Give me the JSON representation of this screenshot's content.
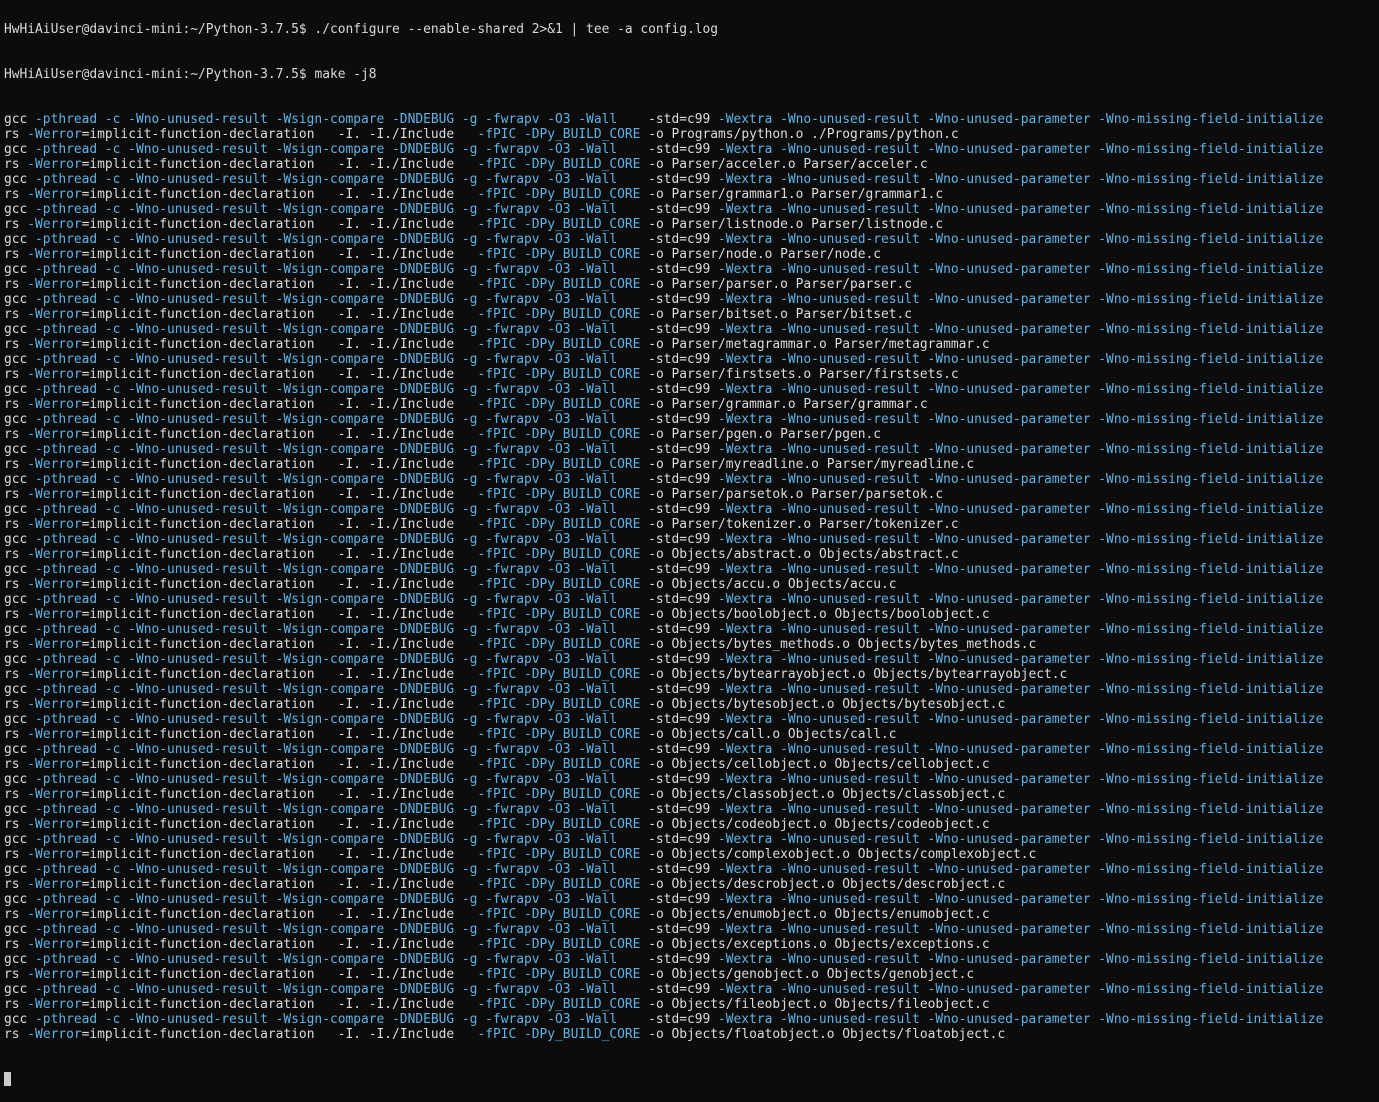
{
  "terminal": {
    "top_partial_line": "HwHiAiUser@davinci-mini:~/Python-3.7.5$ ./configure --enable-shared 2>&1 | tee -a config.log",
    "prompt": "HwHiAiUser@davinci-mini:~/Python-3.7.5$ ",
    "command": "make -j8",
    "line1_segments": [
      {
        "t": "gcc ",
        "c": "w"
      },
      {
        "t": "-pthread -c -Wno-unused-result -Wsign-compare -DNDEBUG -g -fwrapv -O3 -Wall    ",
        "c": "c"
      },
      {
        "t": "-std=c99 ",
        "c": "w"
      },
      {
        "t": "-Wextra -Wno-unused-result -Wno-unused-parameter -Wno-missing-field-initialize",
        "c": "c"
      }
    ],
    "line2_prefix": [
      {
        "t": "rs ",
        "c": "w"
      },
      {
        "t": "-Werror",
        "c": "c"
      },
      {
        "t": "=implicit-function-declaration   -I. -I./Include   ",
        "c": "w"
      },
      {
        "t": "-fPIC -DPy_BUILD_CORE ",
        "c": "c"
      },
      {
        "t": "-o ",
        "c": "w"
      }
    ],
    "compile_targets": [
      "Programs/python.o ./Programs/python.c",
      "Parser/acceler.o Parser/acceler.c",
      "Parser/grammar1.o Parser/grammar1.c",
      "Parser/listnode.o Parser/listnode.c",
      "Parser/node.o Parser/node.c",
      "Parser/parser.o Parser/parser.c",
      "Parser/bitset.o Parser/bitset.c",
      "Parser/metagrammar.o Parser/metagrammar.c",
      "Parser/firstsets.o Parser/firstsets.c",
      "Parser/grammar.o Parser/grammar.c",
      "Parser/pgen.o Parser/pgen.c",
      "Parser/myreadline.o Parser/myreadline.c",
      "Parser/parsetok.o Parser/parsetok.c",
      "Parser/tokenizer.o Parser/tokenizer.c",
      "Objects/abstract.o Objects/abstract.c",
      "Objects/accu.o Objects/accu.c",
      "Objects/boolobject.o Objects/boolobject.c",
      "Objects/bytes_methods.o Objects/bytes_methods.c",
      "Objects/bytearrayobject.o Objects/bytearrayobject.c",
      "Objects/bytesobject.o Objects/bytesobject.c",
      "Objects/call.o Objects/call.c",
      "Objects/cellobject.o Objects/cellobject.c",
      "Objects/classobject.o Objects/classobject.c",
      "Objects/codeobject.o Objects/codeobject.c",
      "Objects/complexobject.o Objects/complexobject.c",
      "Objects/descrobject.o Objects/descrobject.c",
      "Objects/enumobject.o Objects/enumobject.c",
      "Objects/exceptions.o Objects/exceptions.c",
      "Objects/genobject.o Objects/genobject.c",
      "Objects/fileobject.o Objects/fileobject.c",
      "Objects/floatobject.o Objects/floatobject.c"
    ],
    "colors": {
      "background": "#0c0c0c",
      "text": "#d9d9d9",
      "option": "#5fb3e6"
    },
    "cursor_icon": "block-cursor"
  }
}
